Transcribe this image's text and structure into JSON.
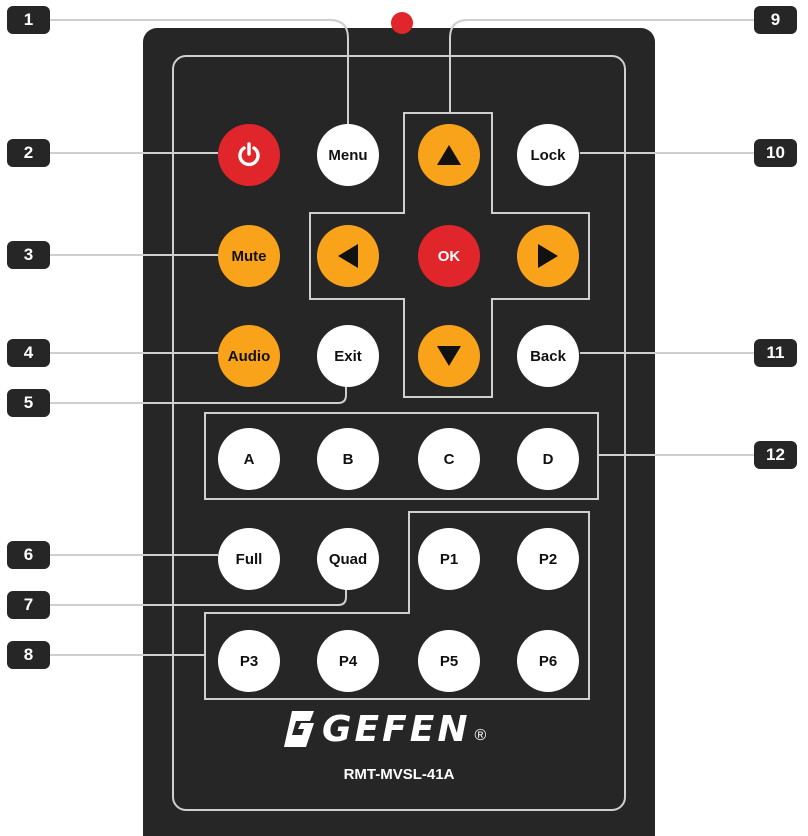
{
  "device": {
    "brand": "GEFEN",
    "registered_mark": "®",
    "model": "RMT-MVSL-41A"
  },
  "colors": {
    "body": "#262626",
    "border": "#cfcfcf",
    "power": "#e0262b",
    "ok": "#e0262b",
    "orange": "#f9a31a",
    "white": "#ffffff",
    "ir_led": "#e0262b"
  },
  "buttons": {
    "power": {
      "icon": "power-icon"
    },
    "menu": "Menu",
    "up": {
      "icon": "arrow-up-icon"
    },
    "lock": "Lock",
    "mute": "Mute",
    "left": {
      "icon": "arrow-left-icon"
    },
    "ok": "OK",
    "right": {
      "icon": "arrow-right-icon"
    },
    "audio": "Audio",
    "exit": "Exit",
    "down": {
      "icon": "arrow-down-icon"
    },
    "back": "Back",
    "a": "A",
    "b": "B",
    "c": "C",
    "d": "D",
    "full": "Full",
    "quad": "Quad",
    "p1": "P1",
    "p2": "P2",
    "p3": "P3",
    "p4": "P4",
    "p5": "P5",
    "p6": "P6"
  },
  "callouts": {
    "c1": "1",
    "c2": "2",
    "c3": "3",
    "c4": "4",
    "c5": "5",
    "c6": "6",
    "c7": "7",
    "c8": "8",
    "c9": "9",
    "c10": "10",
    "c11": "11",
    "c12": "12"
  }
}
